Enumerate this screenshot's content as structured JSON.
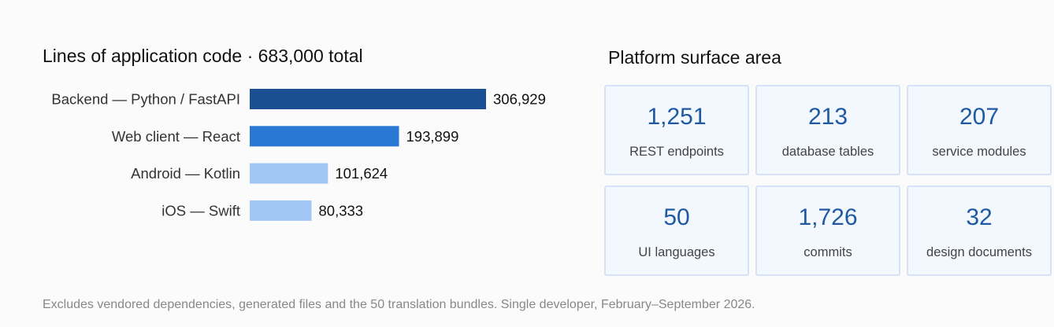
{
  "chart_data": {
    "type": "bar",
    "orientation": "horizontal",
    "title": "Lines of application code  ·  683,000 total",
    "categories": [
      "Backend — Python / FastAPI",
      "Web client — React",
      "Android — Kotlin",
      "iOS — Swift"
    ],
    "values": [
      306929,
      193899,
      101624,
      80333
    ],
    "value_labels": [
      "306,929",
      "193,899",
      "101,624",
      "80,333"
    ],
    "colors": [
      "#1a4f94",
      "#2878d4",
      "#a2c6f5",
      "#a2c6f5"
    ],
    "xlim": [
      0,
      306929
    ],
    "grid": false,
    "legend": "none"
  },
  "surface": {
    "title": "Platform surface area",
    "stats": [
      {
        "value": "1,251",
        "label": "REST endpoints"
      },
      {
        "value": "213",
        "label": "database tables"
      },
      {
        "value": "207",
        "label": "service modules"
      },
      {
        "value": "50",
        "label": "UI languages"
      },
      {
        "value": "1,726",
        "label": "commits"
      },
      {
        "value": "32",
        "label": "design documents"
      }
    ],
    "accent": "#1f5aa1"
  },
  "footnote": "Excludes vendored dependencies, generated files and the 50 translation bundles.  Single developer, February–September 2026."
}
